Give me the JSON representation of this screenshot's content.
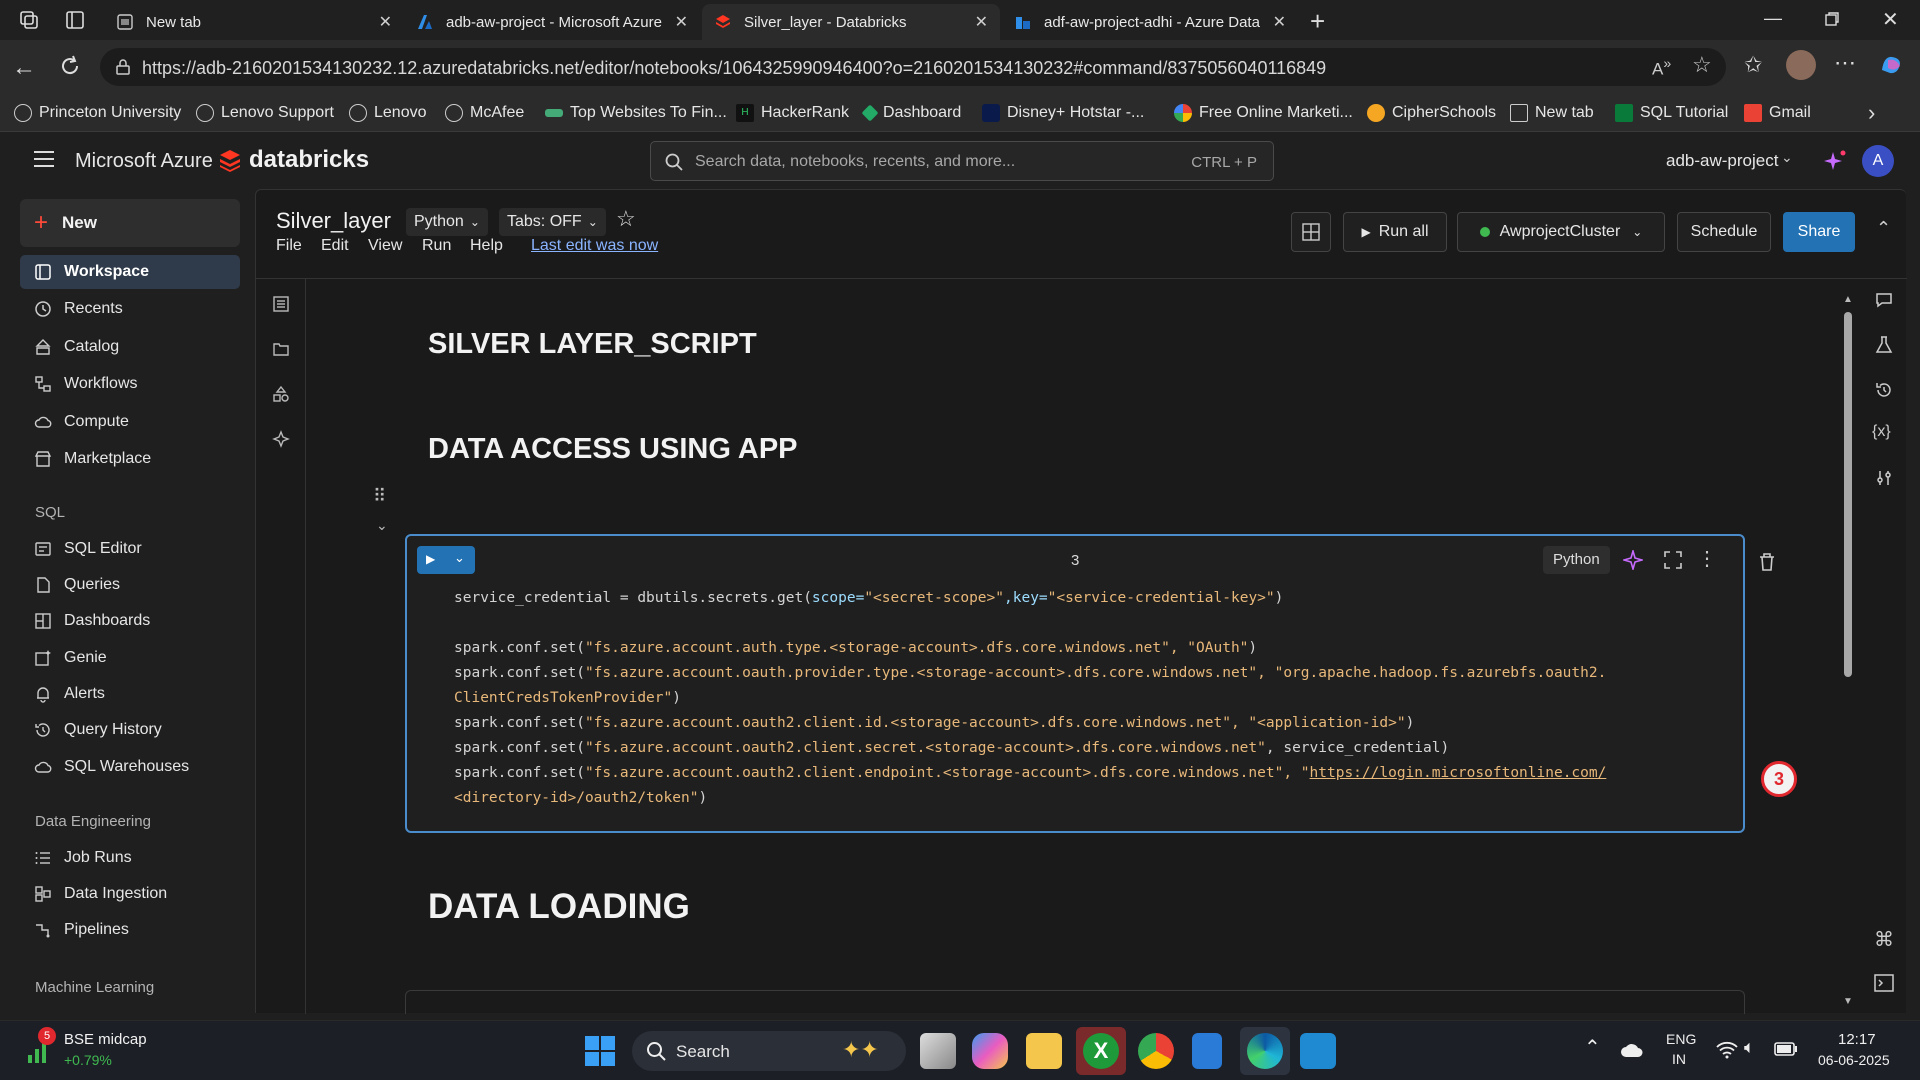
{
  "browser": {
    "tabs": [
      {
        "title": "New tab"
      },
      {
        "title": "adb-aw-project - Microsoft Azure"
      },
      {
        "title": "Silver_layer - Databricks"
      },
      {
        "title": "adf-aw-project-adhi - Azure Data"
      }
    ],
    "url": "https://adb-2160201534130232.12.azuredatabricks.net/editor/notebooks/1064325990946400?o=2160201534130232#command/8375056040116849",
    "bookmarks": [
      "Princeton University",
      "Lenovo Support",
      "Lenovo",
      "McAfee",
      "Top Websites To Fin...",
      "HackerRank",
      "Dashboard",
      "Disney+ Hotstar -...",
      "Free Online Marketi...",
      "CipherSchools",
      "New tab",
      "SQL Tutorial",
      "Gmail"
    ]
  },
  "app": {
    "brand_azure": "Microsoft Azure",
    "brand_databricks": "databricks",
    "search_placeholder": "Search data, notebooks, recents, and more...",
    "search_shortcut": "CTRL + P",
    "workspace_name": "adb-aw-project",
    "avatar_letter": "A"
  },
  "sidebar": {
    "new_label": "New",
    "items_top": [
      "Workspace",
      "Recents",
      "Catalog",
      "Workflows",
      "Compute",
      "Marketplace"
    ],
    "sql_heading": "SQL",
    "items_sql": [
      "SQL Editor",
      "Queries",
      "Dashboards",
      "Genie",
      "Alerts",
      "Query History",
      "SQL Warehouses"
    ],
    "de_heading": "Data Engineering",
    "items_de": [
      "Job Runs",
      "Data Ingestion",
      "Pipelines"
    ],
    "ml_heading": "Machine Learning"
  },
  "notebook": {
    "title": "Silver_layer",
    "language": "Python",
    "tabs_mode": "Tabs: OFF",
    "menu": [
      "File",
      "Edit",
      "View",
      "Run",
      "Help"
    ],
    "last_edit": "Last edit was now",
    "run_all": "Run all",
    "cluster": "AwprojectCluster",
    "schedule": "Schedule",
    "share": "Share",
    "headings": [
      "SILVER LAYER_SCRIPT",
      "DATA ACCESS USING APP",
      "DATA LOADING"
    ],
    "cell": {
      "number": "3",
      "language_badge": "Python",
      "line1_a": "service_credential = dbutils.secrets.get(",
      "line1_k1": "scope=",
      "line1_s1": "\"<secret-scope>\"",
      "line1_k2": ",key=",
      "line1_s2": "\"<service-credential-key>\"",
      "line1_e": ")",
      "line2_a": "spark.conf.set(",
      "line2_s": "\"fs.azure.account.auth.type.<storage-account>.dfs.core.windows.net\", \"OAuth\"",
      "line2_e": ")",
      "line3_a": "spark.conf.set(",
      "line3_s": "\"fs.azure.account.oauth.provider.type.<storage-account>.dfs.core.windows.net\", \"org.apache.hadoop.fs.azurebfs.oauth2.",
      "line3b_s": "ClientCredsTokenProvider\"",
      "line3b_e": ")",
      "line4_a": "spark.conf.set(",
      "line4_s": "\"fs.azure.account.oauth2.client.id.<storage-account>.dfs.core.windows.net\", \"<application-id>\"",
      "line4_e": ")",
      "line5_a": "spark.conf.set(",
      "line5_s": "\"fs.azure.account.oauth2.client.secret.<storage-account>.dfs.core.windows.net\"",
      "line5_e": ", service_credential)",
      "line6_a": "spark.conf.set(",
      "line6_s": "\"fs.azure.account.oauth2.client.endpoint.<storage-account>.dfs.core.windows.net\", \"",
      "line6_link": "https://login.microsoftonline.com/",
      "line7_s": "<directory-id>/oauth2/token\"",
      "line7_e": ")"
    },
    "badge_count": "3"
  },
  "taskbar": {
    "stock_name": "BSE midcap",
    "stock_change": "+0.79%",
    "stock_badge": "5",
    "search_label": "Search",
    "lang_1": "ENG",
    "lang_2": "IN",
    "time": "12:17",
    "date": "06-06-2025"
  },
  "colors": {
    "accent_blue": "#2272b4",
    "cell_border": "#4a8ccc",
    "databricks_red": "#ff3621",
    "cluster_green": "#3fb950"
  }
}
